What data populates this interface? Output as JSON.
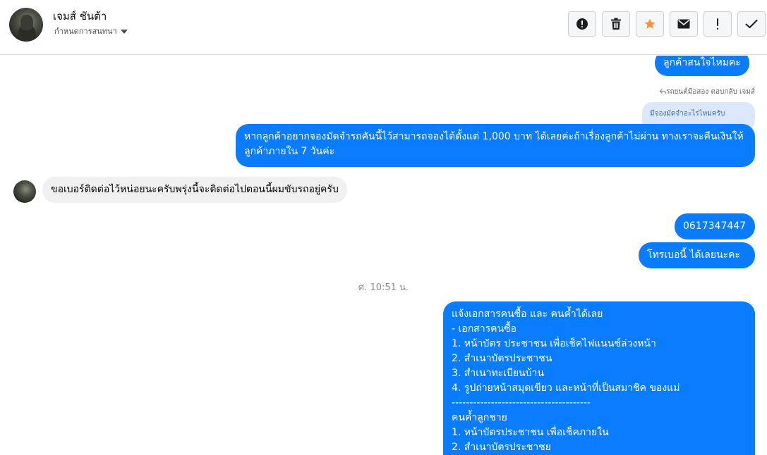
{
  "header": {
    "contact_name": "เจมส์ ชันต้า",
    "conversation_settings_label": "กำหนดการสนทนา",
    "toolbar": [
      {
        "name": "report-button",
        "icon": "alert-circle-icon"
      },
      {
        "name": "delete-button",
        "icon": "trash-icon"
      },
      {
        "name": "star-button",
        "icon": "star-icon",
        "color": "#f7923b"
      },
      {
        "name": "mark-unread-button",
        "icon": "envelope-icon"
      },
      {
        "name": "important-button",
        "icon": "exclamation-icon"
      },
      {
        "name": "mark-done-button",
        "icon": "checkmark-icon"
      }
    ]
  },
  "chat": {
    "msg_top": "ลูกค้าสนใจไหมคะ",
    "reply_meta": "รถยนต์มือสอง ตอบกลับ เจมส์",
    "quoted_text": "มีจองมัดจำอะไรไหมครับ",
    "msg_booking": "หากลูกค้าอยากจองมัดจำรถคันนี้ไว้สามารถจองได้ตั้งแต่ 1,000 บาท ได้เลยค่ะถ้าเรื่องลูกค้าไม่ผ่าน ทางเราจะคืนเงินให้ลูกค้าภายใน 7 วันค่ะ",
    "msg_incoming": "ขอเบอร์ติดต่อไว้หน่อยนะครับพรุ่งนี้จะติดต่อไปตอนนี้ผมขับรถอยู่ครับ",
    "msg_phone": "0617347447",
    "msg_call": "โทรเบอนี้ ได้เลยนะคะ",
    "timestamp": "ศ. 10:51 น.",
    "msg_docs": "แจ้งเอกสารคนซื้อ และ คนค้ำได้เลย\n- เอกสารคนซื้อ\n1. หน้าบัตร ประชาชน เพื่อเช็คไฟแนนซ์ล่วงหน้า\n2. สำเนาบัตรประชาชน\n3. สำเนาทะเบียนบ้าน\n4. รูปถ่ายหน้าสมุดเขียว และหน้าที่เป็นสมาชิค ของแม่\n---------------------------------------\nคนค้ำลูกชาย\n1. หน้าบัตรประชาชน เพื่อเช็คภายใน\n2. สำเนาบัตรประชาชย"
  },
  "colors": {
    "outgoing_bubble": "#0a7cff",
    "incoming_bubble": "#f0f0f0",
    "star": "#f7923b"
  }
}
